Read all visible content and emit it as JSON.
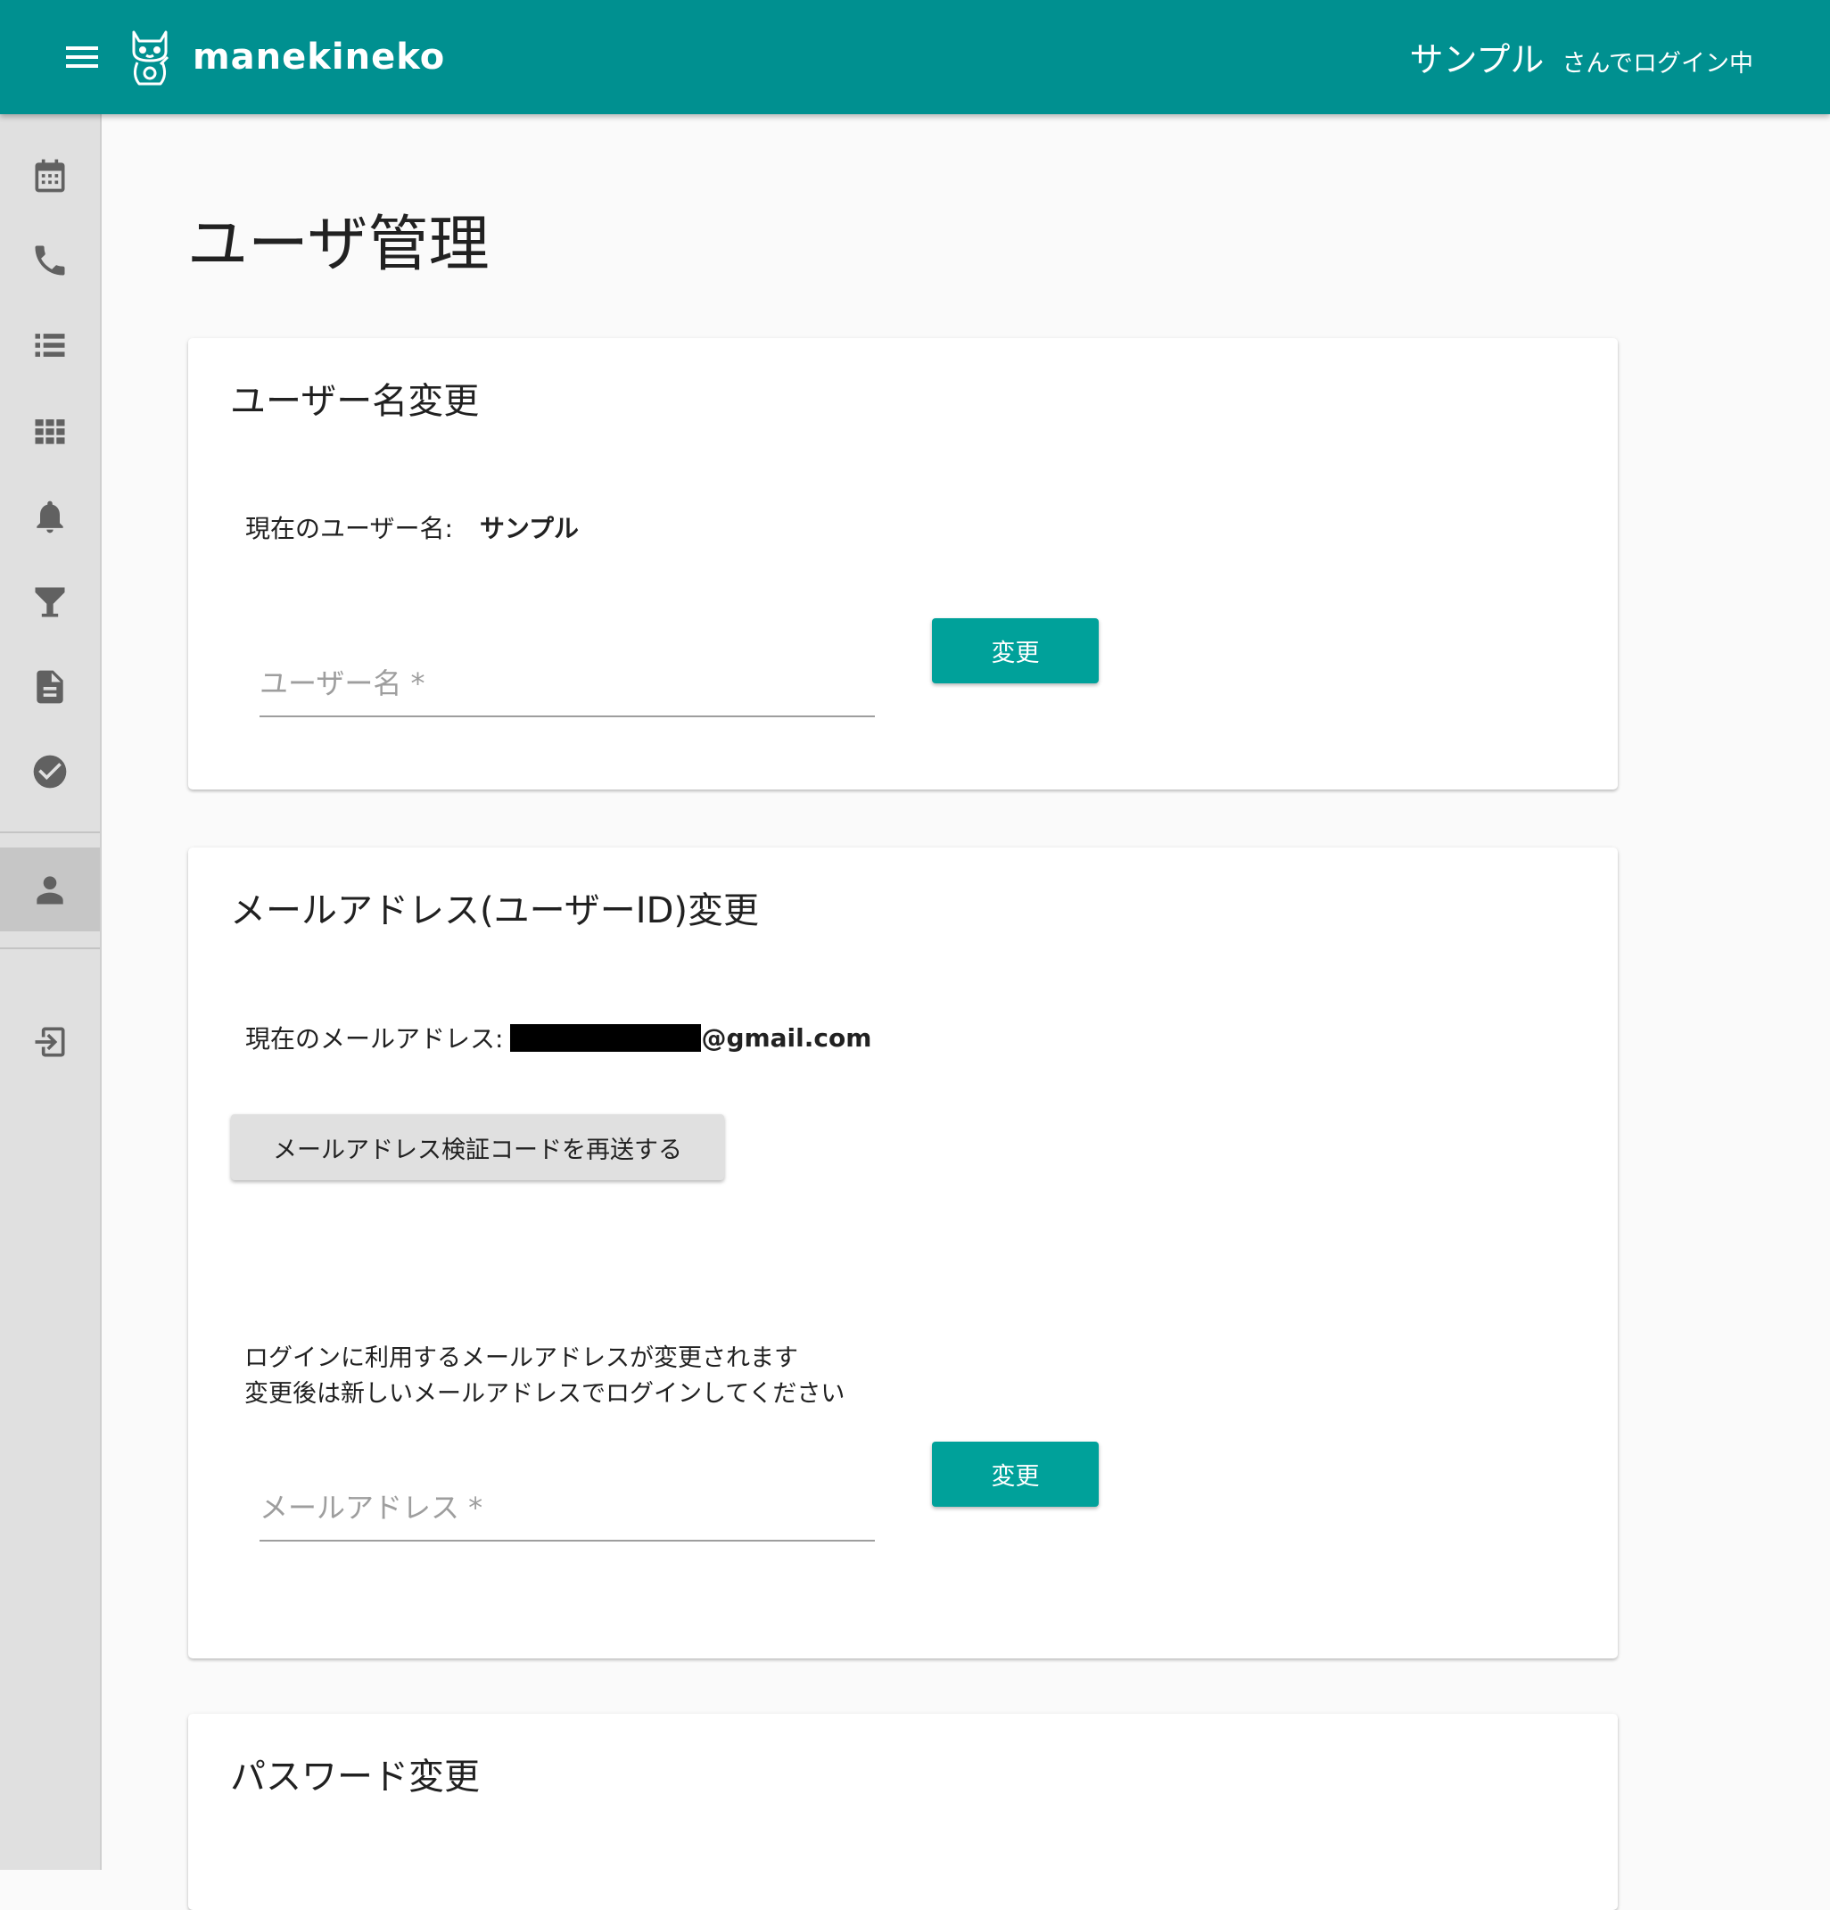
{
  "header": {
    "brand": "manekineko",
    "user_name": "サンプル",
    "login_suffix": "さんでログイン中"
  },
  "sidebar": {
    "items": [
      {
        "icon": "calendar-icon"
      },
      {
        "icon": "phone-icon"
      },
      {
        "icon": "list-icon"
      },
      {
        "icon": "grid-icon"
      },
      {
        "icon": "bell-icon"
      },
      {
        "icon": "filter-icon"
      },
      {
        "icon": "document-icon"
      },
      {
        "icon": "check-circle-icon"
      },
      {
        "icon": "person-icon",
        "active": true
      },
      {
        "icon": "logout-icon"
      }
    ]
  },
  "page": {
    "title": "ユーザ管理"
  },
  "username_card": {
    "title": "ユーザー名変更",
    "current_label": "現在のユーザー名:",
    "current_value": "サンプル",
    "input_placeholder": "ユーザー名 *",
    "submit_label": "変更"
  },
  "email_card": {
    "title": "メールアドレス(ユーザーID)変更",
    "current_label": "現在のメールアドレス:",
    "current_domain": "@gmail.com",
    "resend_label": "メールアドレス検証コードを再送する",
    "note_line1": "ログインに利用するメールアドレスが変更されます",
    "note_line2": "変更後は新しいメールアドレスでログインしてください",
    "input_placeholder": "メールアドレス *",
    "submit_label": "変更"
  },
  "password_card": {
    "title": "パスワード変更"
  },
  "colors": {
    "appbar": "#009090",
    "accent_button": "#00a19a",
    "sidebar": "#e0e0e0",
    "background": "#fafafa"
  }
}
